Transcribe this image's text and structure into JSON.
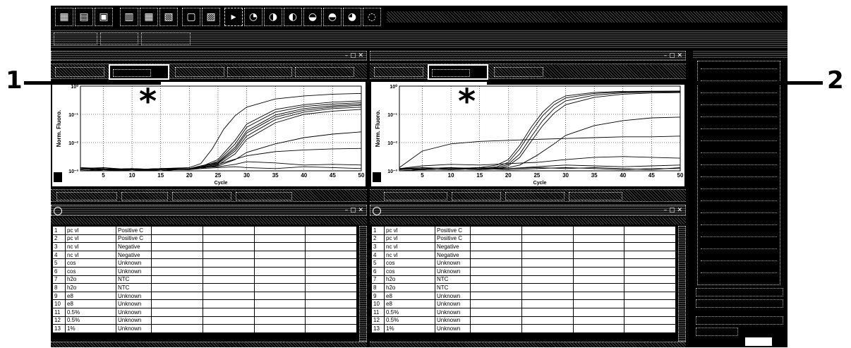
{
  "callouts": [
    {
      "label": "1"
    },
    {
      "label": "2"
    }
  ],
  "icons": {
    "toolbar": [
      "grid-icon",
      "folder-icon",
      "save-icon",
      "print-icon",
      "table-icon",
      "chart-icon",
      "window-icon",
      "zoom-icon"
    ],
    "marker": "asterisk-icon"
  },
  "panels": [
    {
      "chart_data": {
        "type": "line",
        "ylabel": "Norm. Fluoro.",
        "xlabel": "Cycle",
        "xlim": [
          1,
          50
        ],
        "x_ticks": [
          "5",
          "10",
          "15",
          "20",
          "25",
          "30",
          "35",
          "40",
          "45",
          "50"
        ],
        "y_ticks": [
          "10⁰",
          "10⁻¹",
          "10⁻²",
          "10⁻³"
        ],
        "y_scale": "log",
        "ylim": [
          0.001,
          1
        ],
        "marker": "*",
        "series": [
          {
            "x": [
              1,
              5,
              10,
              15,
              20,
              22,
              25,
              28,
              30,
              35,
              40,
              45,
              50
            ],
            "values": [
              0.0012,
              0.001,
              0.0011,
              0.001,
              0.0012,
              0.0014,
              0.0025,
              0.012,
              0.045,
              0.15,
              0.22,
              0.27,
              0.3
            ]
          },
          {
            "x": [
              1,
              5,
              10,
              15,
              20,
              22,
              25,
              28,
              30,
              35,
              40,
              45,
              50
            ],
            "values": [
              0.0011,
              0.0012,
              0.001,
              0.0011,
              0.0011,
              0.0013,
              0.0022,
              0.009,
              0.035,
              0.12,
              0.19,
              0.23,
              0.26
            ]
          },
          {
            "x": [
              1,
              5,
              10,
              15,
              20,
              22,
              25,
              28,
              30,
              35,
              40,
              45,
              50
            ],
            "values": [
              0.0013,
              0.0011,
              0.0012,
              0.001,
              0.0012,
              0.0015,
              0.002,
              0.007,
              0.026,
              0.095,
              0.16,
              0.2,
              0.23
            ]
          },
          {
            "x": [
              1,
              5,
              10,
              15,
              20,
              22,
              25,
              28,
              30,
              35,
              40,
              45,
              50
            ],
            "values": [
              0.001,
              0.0011,
              0.001,
              0.0012,
              0.0011,
              0.0014,
              0.0019,
              0.006,
              0.022,
              0.08,
              0.14,
              0.18,
              0.21
            ]
          },
          {
            "x": [
              1,
              5,
              10,
              15,
              20,
              22,
              25,
              28,
              30,
              35,
              40,
              45,
              50
            ],
            "values": [
              0.0012,
              0.001,
              0.0011,
              0.0012,
              0.0012,
              0.0013,
              0.0018,
              0.005,
              0.017,
              0.065,
              0.12,
              0.16,
              0.18
            ]
          },
          {
            "x": [
              1,
              5,
              10,
              15,
              20,
              22,
              25,
              28,
              30,
              35,
              40,
              45,
              50
            ],
            "values": [
              0.0011,
              0.0012,
              0.0011,
              0.0011,
              0.0012,
              0.0012,
              0.0016,
              0.004,
              0.013,
              0.05,
              0.1,
              0.13,
              0.15
            ]
          },
          {
            "x": [
              1,
              5,
              10,
              15,
              20,
              22,
              24,
              26,
              28,
              30,
              35,
              40,
              45,
              50
            ],
            "values": [
              0.0011,
              0.0012,
              0.0011,
              0.0012,
              0.0013,
              0.0018,
              0.006,
              0.03,
              0.09,
              0.18,
              0.35,
              0.45,
              0.52,
              0.55
            ]
          },
          {
            "x": [
              1,
              5,
              10,
              15,
              20,
              22,
              25,
              28,
              30,
              35,
              40,
              45,
              50
            ],
            "values": [
              0.0012,
              0.0011,
              0.0012,
              0.0011,
              0.0012,
              0.0013,
              0.0015,
              0.0025,
              0.0045,
              0.009,
              0.015,
              0.02,
              0.024
            ]
          },
          {
            "x": [
              1,
              5,
              10,
              15,
              20,
              22,
              25,
              28,
              30,
              35,
              40,
              45,
              50
            ],
            "values": [
              0.0013,
              0.0012,
              0.0011,
              0.0012,
              0.0011,
              0.0012,
              0.0013,
              0.0014,
              0.0013,
              0.0012,
              0.0014,
              0.0013,
              0.0012
            ]
          },
          {
            "x": [
              1,
              5,
              10,
              15,
              20,
              22,
              25,
              28,
              30,
              35,
              40,
              45,
              50
            ],
            "values": [
              0.001,
              0.0011,
              0.0012,
              0.0011,
              0.0012,
              0.0013,
              0.0014,
              0.0017,
              0.0021,
              0.0019,
              0.0016,
              0.0017,
              0.0016
            ]
          },
          {
            "x": [
              1,
              5,
              10,
              15,
              20,
              22,
              25,
              28,
              30,
              35,
              40,
              45,
              50
            ],
            "values": [
              0.0012,
              0.0013,
              0.0011,
              0.0012,
              0.0012,
              0.0013,
              0.0017,
              0.0026,
              0.0034,
              0.0048,
              0.0055,
              0.006,
              0.0062
            ]
          }
        ]
      },
      "table": {
        "rows": [
          [
            "1",
            "pc vl",
            "Positive C"
          ],
          [
            "2",
            "pc vl",
            "Positive C"
          ],
          [
            "3",
            "nc vl",
            "Negative"
          ],
          [
            "4",
            "nc vl",
            "Negative"
          ],
          [
            "5",
            "cos",
            "Unknown"
          ],
          [
            "6",
            "cos",
            "Unknown"
          ],
          [
            "7",
            "h2o",
            "NTC"
          ],
          [
            "8",
            "h2o",
            "NTC"
          ],
          [
            "9",
            "e8",
            "Unknown"
          ],
          [
            "10",
            "e8",
            "Unknown"
          ],
          [
            "11",
            "0.5%",
            "Unknown"
          ],
          [
            "12",
            "0.5%",
            "Unknown"
          ],
          [
            "13",
            "1%",
            "Unknown"
          ]
        ]
      }
    },
    {
      "chart_data": {
        "type": "line",
        "ylabel": "Norm. Fluoro.",
        "xlabel": "Cycle",
        "xlim": [
          1,
          50
        ],
        "x_ticks": [
          "5",
          "10",
          "15",
          "20",
          "25",
          "30",
          "35",
          "40",
          "45",
          "50"
        ],
        "y_ticks": [
          "10⁰",
          "10⁻¹",
          "10⁻²",
          "10⁻³"
        ],
        "y_scale": "log",
        "ylim": [
          0.001,
          1
        ],
        "marker": "*",
        "series": [
          {
            "x": [
              1,
              5,
              10,
              15,
              18,
              20,
              22,
              24,
              26,
              28,
              30,
              35,
              40,
              45,
              50
            ],
            "values": [
              0.0012,
              0.0011,
              0.0012,
              0.0013,
              0.0016,
              0.0025,
              0.008,
              0.035,
              0.12,
              0.28,
              0.45,
              0.6,
              0.65,
              0.66,
              0.67
            ]
          },
          {
            "x": [
              1,
              5,
              10,
              15,
              18,
              20,
              22,
              24,
              26,
              28,
              30,
              35,
              40,
              45,
              50
            ],
            "values": [
              0.0011,
              0.0012,
              0.0011,
              0.0012,
              0.0014,
              0.002,
              0.006,
              0.025,
              0.09,
              0.22,
              0.38,
              0.55,
              0.62,
              0.64,
              0.65
            ]
          },
          {
            "x": [
              1,
              5,
              10,
              15,
              18,
              20,
              22,
              24,
              26,
              28,
              30,
              35,
              40,
              45,
              50
            ],
            "values": [
              0.0012,
              0.0012,
              0.0013,
              0.0012,
              0.0013,
              0.0017,
              0.004,
              0.016,
              0.06,
              0.16,
              0.3,
              0.48,
              0.58,
              0.61,
              0.62
            ]
          },
          {
            "x": [
              1,
              5,
              10,
              15,
              18,
              20,
              22,
              24,
              26,
              28,
              30,
              35,
              40,
              45,
              50
            ],
            "values": [
              0.001,
              0.0011,
              0.0012,
              0.0011,
              0.0012,
              0.0015,
              0.003,
              0.011,
              0.04,
              0.11,
              0.22,
              0.4,
              0.52,
              0.57,
              0.59
            ]
          },
          {
            "x": [
              1,
              5,
              10,
              15,
              20,
              22,
              25,
              28,
              30,
              35,
              40,
              45,
              50
            ],
            "values": [
              0.0012,
              0.0011,
              0.0012,
              0.0012,
              0.0013,
              0.0016,
              0.0035,
              0.009,
              0.018,
              0.04,
              0.06,
              0.075,
              0.08
            ]
          },
          {
            "x": [
              1,
              5,
              10,
              15,
              20,
              25,
              30,
              35,
              40,
              45,
              50
            ],
            "values": [
              0.0013,
              0.005,
              0.009,
              0.011,
              0.012,
              0.013,
              0.014,
              0.015,
              0.016,
              0.016,
              0.017
            ]
          },
          {
            "x": [
              1,
              5,
              10,
              15,
              20,
              25,
              30,
              35,
              40,
              45,
              50
            ],
            "values": [
              0.0012,
              0.0015,
              0.0017,
              0.0016,
              0.0018,
              0.002,
              0.0025,
              0.003,
              0.0032,
              0.003,
              0.0028
            ]
          },
          {
            "x": [
              1,
              5,
              10,
              15,
              20,
              25,
              30,
              35,
              40,
              45,
              50
            ],
            "values": [
              0.0012,
              0.0011,
              0.0012,
              0.0013,
              0.0012,
              0.0014,
              0.0016,
              0.0015,
              0.0014,
              0.0015,
              0.0016
            ]
          },
          {
            "x": [
              1,
              5,
              10,
              15,
              20,
              25,
              30,
              35,
              40,
              45,
              50
            ],
            "values": [
              0.0011,
              0.0012,
              0.0011,
              0.0012,
              0.0011,
              0.0012,
              0.0013,
              0.0012,
              0.0011,
              0.0012,
              0.0012
            ]
          },
          {
            "x": [
              1,
              5,
              10,
              15,
              20,
              25,
              30,
              35,
              40,
              45,
              50
            ],
            "values": [
              0.0012,
              0.0013,
              0.0012,
              0.0011,
              0.0012,
              0.0013,
              0.0012,
              0.0013,
              0.0012,
              0.0011,
              0.0013
            ]
          }
        ]
      },
      "table": {
        "rows": [
          [
            "1",
            "pc vl",
            "Positive C"
          ],
          [
            "2",
            "pc vl",
            "Positive C"
          ],
          [
            "3",
            "nc vl",
            "Negative"
          ],
          [
            "4",
            "nc vl",
            "Negative"
          ],
          [
            "5",
            "cos",
            "Unknown"
          ],
          [
            "6",
            "cos",
            "Unknown"
          ],
          [
            "7",
            "h2o",
            "NTC"
          ],
          [
            "8",
            "h2o",
            "NTC"
          ],
          [
            "9",
            "e8",
            "Unknown"
          ],
          [
            "10",
            "e8",
            "Unknown"
          ],
          [
            "11",
            "0.5%",
            "Unknown"
          ],
          [
            "12",
            "0.5%",
            "Unknown"
          ],
          [
            "13",
            "1%",
            "Unknown"
          ]
        ]
      }
    }
  ]
}
